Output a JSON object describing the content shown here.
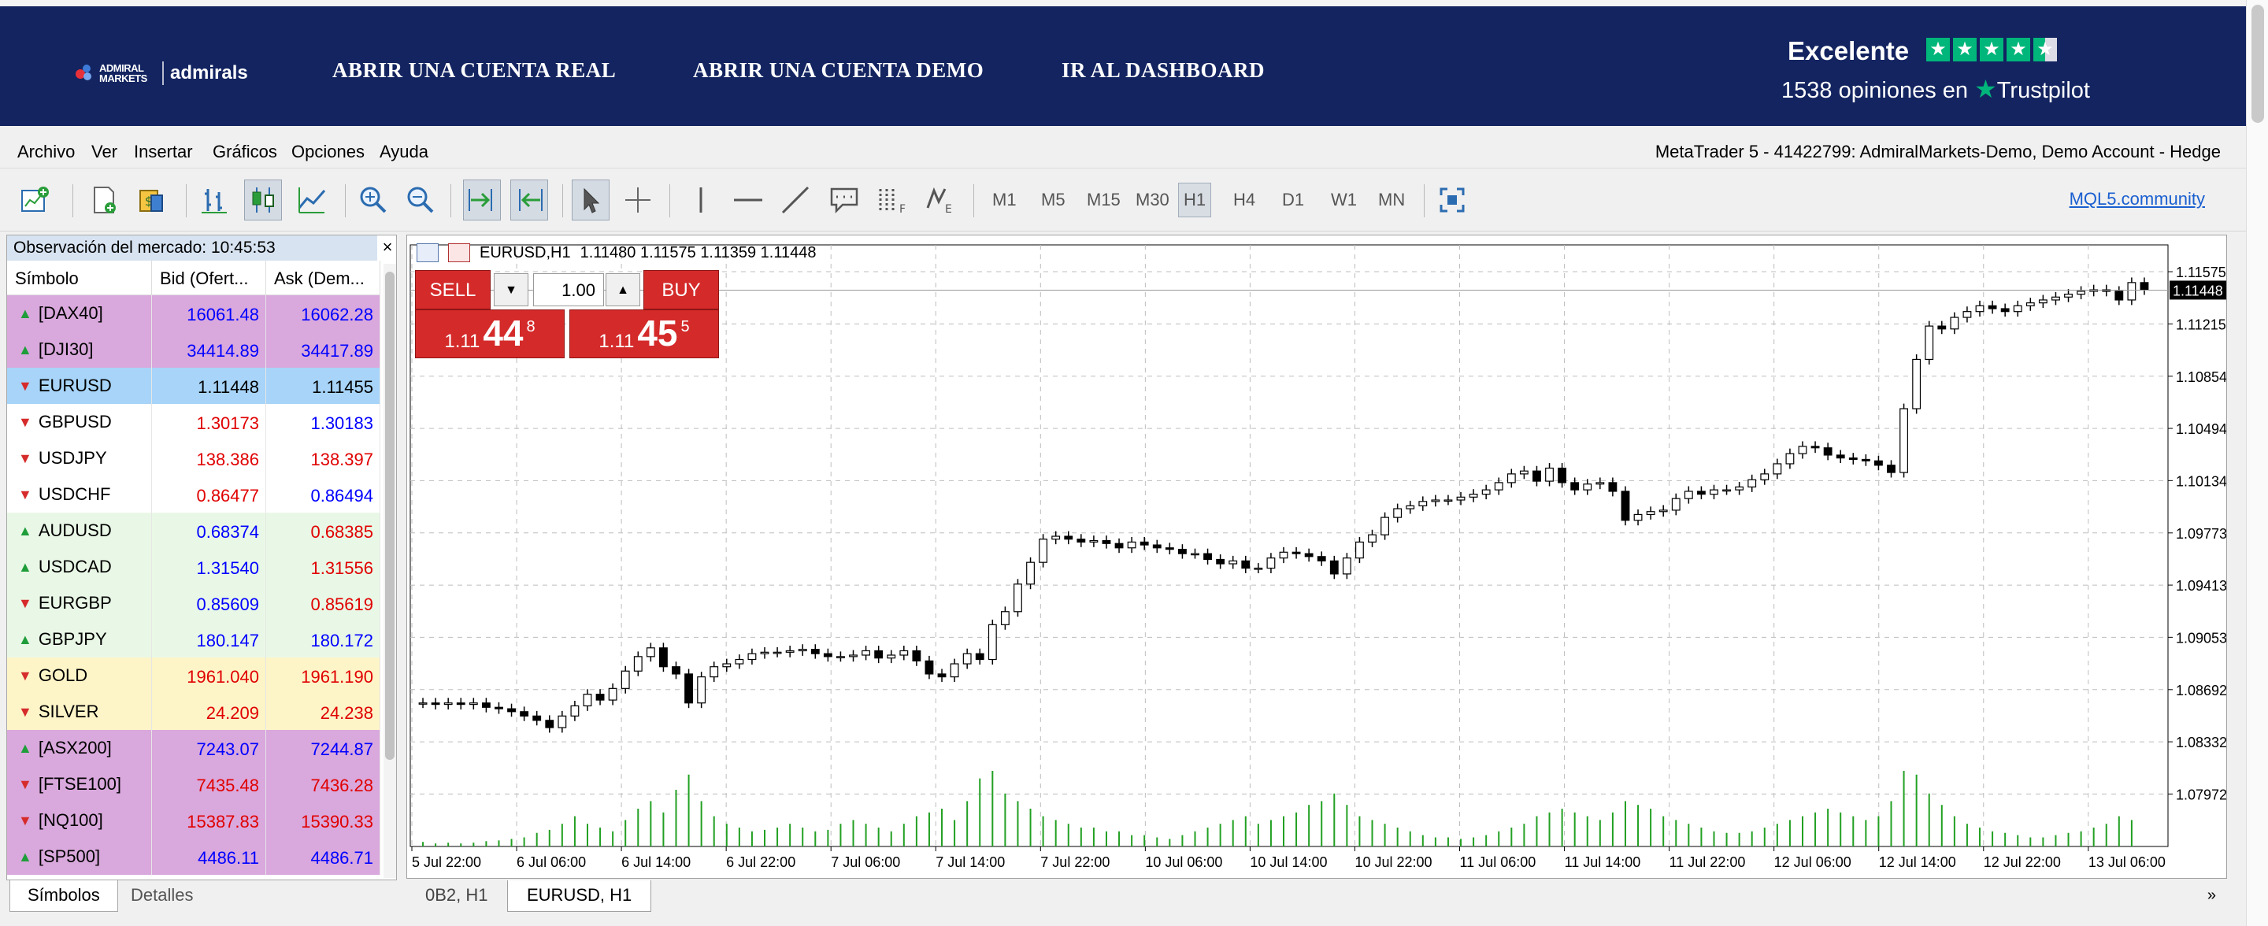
{
  "header": {
    "logo_small": "ADMIRAL MARKETS",
    "logo_main": "admirals",
    "nav": [
      "ABRIR UNA CUENTA REAL",
      "ABRIR UNA CUENTA DEMO",
      "IR AL DASHBOARD"
    ],
    "trustpilot_rating": "Excelente",
    "trustpilot_stars": 4.5,
    "trustpilot_reviews": "1538 opiniones en",
    "trustpilot_brand": "Trustpilot",
    "brand_color": "#132460",
    "star_color": "#00b67a"
  },
  "menu": {
    "items": [
      "Archivo",
      "Ver",
      "Insertar",
      "Gráficos",
      "Opciones",
      "Ayuda"
    ],
    "account": "MetaTrader 5 - 41422799: AdmiralMarkets-Demo, Demo Account - Hedge"
  },
  "toolbar": {
    "icons": [
      "new-chart-icon",
      "new-order-icon",
      "algo-trading-icon",
      "bar-chart-icon",
      "candlestick-icon",
      "line-chart-icon",
      "zoom-in-icon",
      "zoom-out-icon",
      "autoscroll-icon",
      "chart-shift-icon",
      "cursor-icon",
      "crosshair-icon",
      "vertical-line-icon",
      "horizontal-line-icon",
      "trendline-icon",
      "text-icon",
      "fibonacci-icon",
      "elliott-icon",
      "fullscreen-icon"
    ],
    "timeframes": [
      "M1",
      "M5",
      "M15",
      "M30",
      "H1",
      "H4",
      "D1",
      "W1",
      "MN"
    ],
    "active_timeframe": "H1",
    "mql_link": "MQL5.community"
  },
  "market_watch": {
    "title": "Observación del mercado: 10:45:53",
    "columns": [
      "Símbolo",
      "Bid (Ofert...",
      "Ask (Dem..."
    ],
    "rows": [
      {
        "symbol": "[DAX40]",
        "bid": "16061.48",
        "ask": "16062.28",
        "dir": "up",
        "bg": "#d9a8dc",
        "bid_color": "#0000ff",
        "ask_color": "#0000ff"
      },
      {
        "symbol": "[DJI30]",
        "bid": "34414.89",
        "ask": "34417.89",
        "dir": "up",
        "bg": "#d9a8dc",
        "bid_color": "#0000ff",
        "ask_color": "#0000ff"
      },
      {
        "symbol": "EURUSD",
        "bid": "1.11448",
        "ask": "1.11455",
        "dir": "down",
        "bg": "#a7d4f8",
        "bid_color": "#000000",
        "ask_color": "#000000"
      },
      {
        "symbol": "GBPUSD",
        "bid": "1.30173",
        "ask": "1.30183",
        "dir": "down",
        "bg": "#ffffff",
        "bid_color": "#e00000",
        "ask_color": "#0000ff"
      },
      {
        "symbol": "USDJPY",
        "bid": "138.386",
        "ask": "138.397",
        "dir": "down",
        "bg": "#ffffff",
        "bid_color": "#e00000",
        "ask_color": "#e00000"
      },
      {
        "symbol": "USDCHF",
        "bid": "0.86477",
        "ask": "0.86494",
        "dir": "down",
        "bg": "#ffffff",
        "bid_color": "#e00000",
        "ask_color": "#0000ff"
      },
      {
        "symbol": "AUDUSD",
        "bid": "0.68374",
        "ask": "0.68385",
        "dir": "up",
        "bg": "#e9f8e6",
        "bid_color": "#0000ff",
        "ask_color": "#e00000"
      },
      {
        "symbol": "USDCAD",
        "bid": "1.31540",
        "ask": "1.31556",
        "dir": "up",
        "bg": "#e9f8e6",
        "bid_color": "#0000ff",
        "ask_color": "#e00000"
      },
      {
        "symbol": "EURGBP",
        "bid": "0.85609",
        "ask": "0.85619",
        "dir": "down",
        "bg": "#e9f8e6",
        "bid_color": "#0000ff",
        "ask_color": "#e00000"
      },
      {
        "symbol": "GBPJPY",
        "bid": "180.147",
        "ask": "180.172",
        "dir": "up",
        "bg": "#e9f8e6",
        "bid_color": "#0000ff",
        "ask_color": "#0000ff"
      },
      {
        "symbol": "GOLD",
        "bid": "1961.040",
        "ask": "1961.190",
        "dir": "down",
        "bg": "#fdf4c8",
        "bid_color": "#e00000",
        "ask_color": "#e00000"
      },
      {
        "symbol": "SILVER",
        "bid": "24.209",
        "ask": "24.238",
        "dir": "down",
        "bg": "#fdf4c8",
        "bid_color": "#e00000",
        "ask_color": "#e00000"
      },
      {
        "symbol": "[ASX200]",
        "bid": "7243.07",
        "ask": "7244.87",
        "dir": "up",
        "bg": "#d9a8dc",
        "bid_color": "#0000ff",
        "ask_color": "#0000ff"
      },
      {
        "symbol": "[FTSE100]",
        "bid": "7435.48",
        "ask": "7436.28",
        "dir": "down",
        "bg": "#d9a8dc",
        "bid_color": "#e00000",
        "ask_color": "#e00000"
      },
      {
        "symbol": "[NQ100]",
        "bid": "15387.83",
        "ask": "15390.33",
        "dir": "down",
        "bg": "#d9a8dc",
        "bid_color": "#e00000",
        "ask_color": "#e00000"
      },
      {
        "symbol": "[SP500]",
        "bid": "4486.11",
        "ask": "4486.71",
        "dir": "up",
        "bg": "#d9a8dc",
        "bid_color": "#0000ff",
        "ask_color": "#0000ff"
      }
    ],
    "tabs": [
      "Símbolos",
      "Detalles"
    ]
  },
  "chart": {
    "label": "EURUSD,H1",
    "ohlc": "1.11480 1.11575 1.11359 1.11448",
    "trade": {
      "sell": "SELL",
      "buy": "BUY",
      "volume": "1.00",
      "sell_pre": "1.11",
      "sell_big": "44",
      "sell_sup": "8",
      "buy_pre": "1.11",
      "buy_big": "45",
      "buy_sup": "5"
    },
    "tabs": [
      "0B2, H1",
      "EURUSD, H1"
    ],
    "more_icon": "»"
  },
  "chart_data": {
    "type": "candlestick",
    "symbol": "EURUSD",
    "timeframe": "H1",
    "ylim": [
      1.0761,
      1.1176
    ],
    "y_ticks": [
      "1.11575",
      "1.11215",
      "1.10854",
      "1.10494",
      "1.10134",
      "1.09773",
      "1.09413",
      "1.09053",
      "1.08692",
      "1.08332",
      "1.07972"
    ],
    "x_ticks": [
      "5 Jul 22:00",
      "6 Jul 06:00",
      "6 Jul 14:00",
      "6 Jul 22:00",
      "7 Jul 06:00",
      "7 Jul 14:00",
      "7 Jul 22:00",
      "10 Jul 06:00",
      "10 Jul 14:00",
      "10 Jul 22:00",
      "11 Jul 06:00",
      "11 Jul 14:00",
      "11 Jul 22:00",
      "12 Jul 06:00",
      "12 Jul 14:00",
      "12 Jul 22:00",
      "13 Jul 06:00"
    ],
    "current_price": "1.11448",
    "grid": true,
    "close": [
      1.086,
      1.0859,
      1.086,
      1.0859,
      1.086,
      1.0857,
      1.0856,
      1.0854,
      1.0851,
      1.0848,
      1.0843,
      1.0851,
      1.0858,
      1.0866,
      1.0862,
      1.087,
      1.0882,
      1.0892,
      1.0898,
      1.0885,
      1.088,
      1.086,
      1.0878,
      1.0885,
      1.0887,
      1.089,
      1.0894,
      1.0895,
      1.0895,
      1.0896,
      1.0897,
      1.0894,
      1.0892,
      1.0892,
      1.0893,
      1.0896,
      1.0891,
      1.0893,
      1.0896,
      1.0889,
      1.088,
      1.0878,
      1.0887,
      1.0894,
      1.089,
      1.0914,
      1.0923,
      1.0942,
      1.0957,
      1.0973,
      1.0975,
      1.0973,
      1.0971,
      1.0972,
      1.097,
      1.0967,
      1.0971,
      1.0969,
      1.0967,
      1.0966,
      1.0963,
      1.0963,
      1.0959,
      1.0956,
      1.0958,
      1.0953,
      1.0953,
      1.096,
      1.0964,
      1.0963,
      1.0961,
      1.0958,
      1.0949,
      1.096,
      1.0971,
      1.0976,
      1.0988,
      1.0994,
      1.0996,
      1.0999,
      1.1,
      1.1,
      1.1002,
      1.1004,
      1.1007,
      1.1012,
      1.1018,
      1.102,
      1.1013,
      1.1022,
      1.1012,
      1.1007,
      1.1011,
      1.1012,
      1.1006,
      1.0986,
      1.099,
      1.0992,
      1.0993,
      1.1001,
      1.1006,
      1.1004,
      1.1007,
      1.1007,
      1.1009,
      1.1014,
      1.1018,
      1.1025,
      1.1032,
      1.1037,
      1.1036,
      1.1031,
      1.1029,
      1.1028,
      1.1027,
      1.1024,
      1.1019,
      1.1063,
      1.1097,
      1.112,
      1.1118,
      1.1126,
      1.113,
      1.1134,
      1.1132,
      1.113,
      1.1134,
      1.1136,
      1.1138,
      1.114,
      1.1142,
      1.1144,
      1.1145,
      1.1144,
      1.1138,
      1.115,
      1.1145
    ],
    "volume": [
      0.06,
      0.04,
      0.05,
      0.04,
      0.05,
      0.07,
      0.08,
      0.1,
      0.12,
      0.18,
      0.22,
      0.3,
      0.4,
      0.3,
      0.25,
      0.2,
      0.35,
      0.5,
      0.6,
      0.45,
      0.75,
      0.95,
      0.6,
      0.4,
      0.3,
      0.25,
      0.2,
      0.22,
      0.25,
      0.3,
      0.25,
      0.2,
      0.22,
      0.3,
      0.35,
      0.3,
      0.25,
      0.2,
      0.3,
      0.4,
      0.45,
      0.5,
      0.35,
      0.6,
      0.9,
      1.0,
      0.7,
      0.6,
      0.5,
      0.4,
      0.35,
      0.3,
      0.25,
      0.25,
      0.2,
      0.2,
      0.15,
      0.15,
      0.12,
      0.1,
      0.15,
      0.2,
      0.25,
      0.3,
      0.35,
      0.4,
      0.3,
      0.35,
      0.4,
      0.45,
      0.55,
      0.6,
      0.7,
      0.55,
      0.4,
      0.35,
      0.3,
      0.25,
      0.2,
      0.15,
      0.12,
      0.12,
      0.1,
      0.12,
      0.15,
      0.2,
      0.25,
      0.3,
      0.4,
      0.45,
      0.5,
      0.45,
      0.4,
      0.35,
      0.45,
      0.6,
      0.55,
      0.5,
      0.4,
      0.35,
      0.3,
      0.25,
      0.2,
      0.18,
      0.18,
      0.2,
      0.25,
      0.3,
      0.35,
      0.4,
      0.45,
      0.5,
      0.45,
      0.4,
      0.35,
      0.4,
      0.6,
      1.0,
      0.95,
      0.7,
      0.55,
      0.4,
      0.3,
      0.25,
      0.2,
      0.18,
      0.15,
      0.12,
      0.12,
      0.15,
      0.18,
      0.2,
      0.25,
      0.3,
      0.4,
      0.35
    ]
  }
}
